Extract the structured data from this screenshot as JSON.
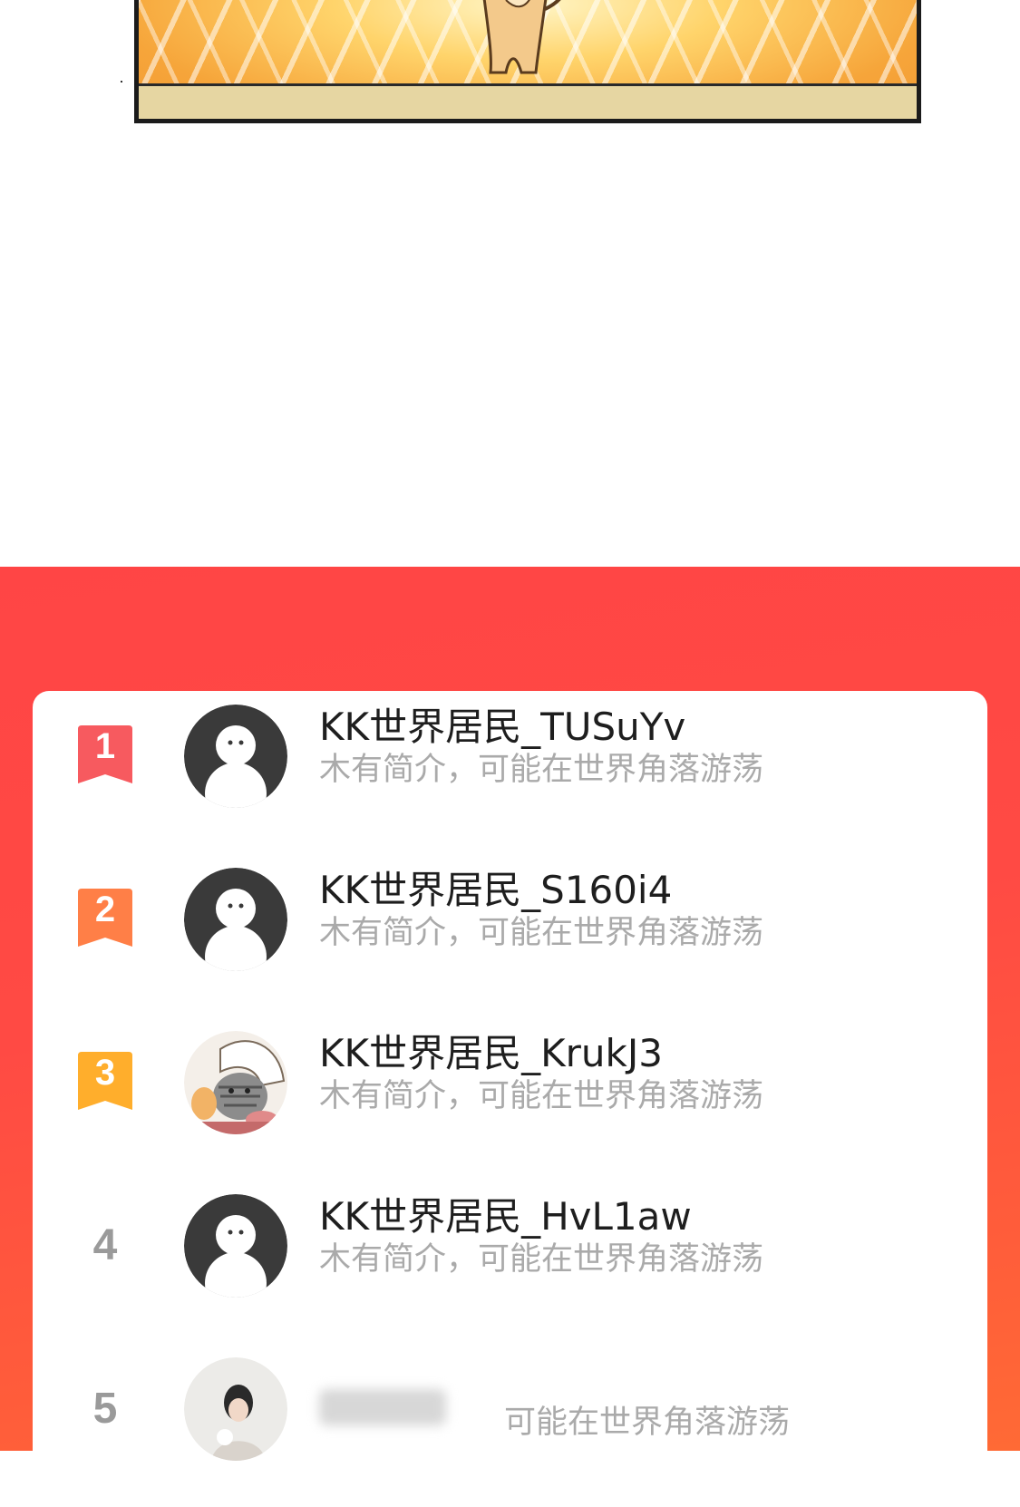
{
  "colors": {
    "section_bg": "#ff4a44",
    "badge_1": "#f75a5f",
    "badge_2": "#ff7f47",
    "badge_3": "#ffae2c",
    "rank_plain": "#9a9a9a",
    "username": "#1e1e1e",
    "bio": "#aaaaaa"
  },
  "ranking": [
    {
      "rank": "1",
      "name": "KK世界居民_TUSuYv",
      "bio": "木有简介，可能在世界角落游荡",
      "avatar": "default-avatar-icon",
      "badge": "ribbon"
    },
    {
      "rank": "2",
      "name": "KK世界居民_S160i4",
      "bio": "木有简介，可能在世界角落游荡",
      "avatar": "default-avatar-icon",
      "badge": "ribbon"
    },
    {
      "rank": "3",
      "name": "KK世界居民_KrukJ3",
      "bio": "木有简介，可能在世界角落游荡",
      "avatar": "cat-avatar-icon",
      "badge": "ribbon"
    },
    {
      "rank": "4",
      "name": "KK世界居民_HvL1aw",
      "bio": "木有简介，可能在世界角落游荡",
      "avatar": "default-avatar-icon",
      "badge": "plain"
    },
    {
      "rank": "5",
      "name": "",
      "bio": "可能在世界角落游荡",
      "avatar": "photo-avatar-icon",
      "badge": "plain"
    }
  ]
}
